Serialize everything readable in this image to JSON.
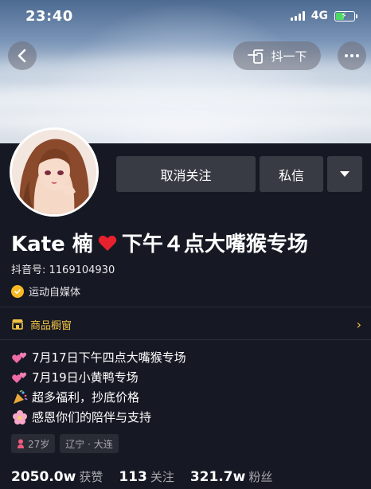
{
  "status_bar": {
    "time": "23:40",
    "network": "4G"
  },
  "top_bar": {
    "shake_label": "抖一下"
  },
  "profile": {
    "name": "Kate 楠",
    "name_suffix": "下午４点大嘴猴专场",
    "douyin_id": "抖音号: 1169104930",
    "verified_label": "运动自媒体"
  },
  "actions": {
    "unfollow_label": "取消关注",
    "message_label": "私信"
  },
  "shop": {
    "label": "商品橱窗"
  },
  "bio": [
    {
      "icon": "two-hearts-icon",
      "text": "7月17日下午四点大嘴猴专场"
    },
    {
      "icon": "two-hearts-icon",
      "text": "7月19日小黄鸭专场"
    },
    {
      "icon": "party-popper-icon",
      "text": "超多福利，抄底价格"
    },
    {
      "icon": "cherry-blossom-icon",
      "text": "感恩你们的陪伴与支持"
    }
  ],
  "tags": [
    {
      "icon": "female-icon",
      "text": "27岁"
    },
    {
      "icon": "",
      "text": "辽宁 · 大连"
    }
  ],
  "stats": [
    {
      "value": "2050.0w",
      "label": "获赞"
    },
    {
      "value": "113",
      "label": "关注"
    },
    {
      "value": "321.7w",
      "label": "粉丝"
    }
  ],
  "colors": {
    "background": "#161823",
    "accent_yellow": "#f5c644",
    "button_bg": "#393b44",
    "battery_green": "#4cd964"
  }
}
